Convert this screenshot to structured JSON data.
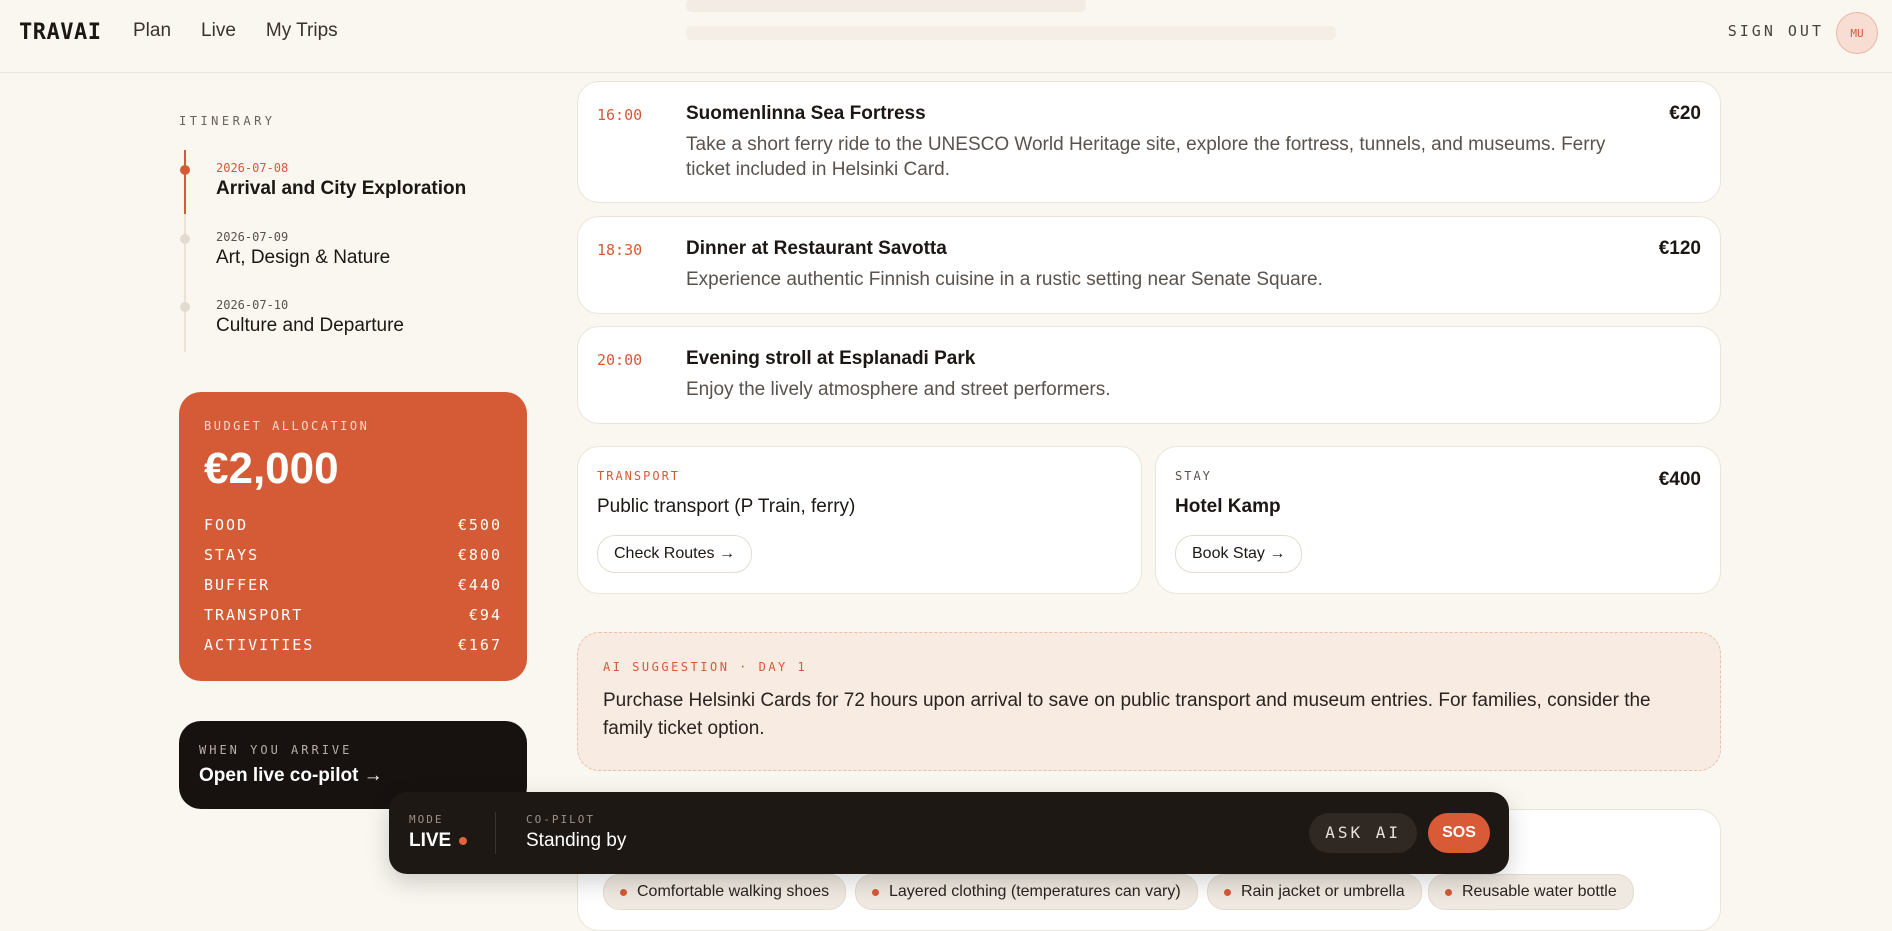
{
  "header": {
    "logo": "TRAVAI",
    "nav": [
      "Plan",
      "Live",
      "My Trips"
    ],
    "sign_out": "SIGN OUT",
    "avatar": "MU"
  },
  "sidebar": {
    "itinerary_label": "ITINERARY",
    "days": [
      {
        "date": "2026-07-08",
        "title": "Arrival and City Exploration",
        "active": true
      },
      {
        "date": "2026-07-09",
        "title": "Art, Design & Nature",
        "active": false
      },
      {
        "date": "2026-07-10",
        "title": "Culture and Departure",
        "active": false
      }
    ],
    "budget": {
      "label": "BUDGET ALLOCATION",
      "total": "€2,000",
      "rows": [
        {
          "label": "FOOD",
          "value": "€500"
        },
        {
          "label": "STAYS",
          "value": "€800"
        },
        {
          "label": "BUFFER",
          "value": "€440"
        },
        {
          "label": "TRANSPORT",
          "value": "€94"
        },
        {
          "label": "ACTIVITIES",
          "value": "€167"
        }
      ]
    },
    "copilot_card": {
      "label": "WHEN YOU ARRIVE",
      "link": "Open live co-pilot →"
    }
  },
  "activities": [
    {
      "time": "16:00",
      "title": "Suomenlinna Sea Fortress",
      "desc": "Take a short ferry ride to the UNESCO World Heritage site, explore the fortress, tunnels, and museums. Ferry ticket included in Helsinki Card.",
      "price": "€20"
    },
    {
      "time": "18:30",
      "title": "Dinner at Restaurant Savotta",
      "desc": "Experience authentic Finnish cuisine in a rustic setting near Senate Square.",
      "price": "€120"
    },
    {
      "time": "20:00",
      "title": "Evening stroll at Esplanadi Park",
      "desc": "Enjoy the lively atmosphere and street performers.",
      "price": ""
    }
  ],
  "transport": {
    "label": "TRANSPORT",
    "title": "Public transport (P Train, ferry)",
    "button": "Check Routes →"
  },
  "stay": {
    "label": "STAY",
    "title": "Hotel Kamp",
    "price": "€400",
    "button": "Book Stay →"
  },
  "ai_suggestion": {
    "label": "AI SUGGESTION · DAY 1",
    "text": "Purchase Helsinki Cards for 72 hours upon arrival to save on public transport and museum entries. For families, consider the family ticket option."
  },
  "packing": [
    "Comfortable walking shoes",
    "Layered clothing (temperatures can vary)",
    "Rain jacket or umbrella",
    "Reusable water bottle"
  ],
  "floatbar": {
    "mode_label": "MODE",
    "mode": "LIVE",
    "copilot_label": "CO-PILOT",
    "copilot_status": "Standing by",
    "ask_ai": "ASK AI",
    "sos": "SOS"
  },
  "colors": {
    "accent": "#d55b36",
    "background": "#faf6f0",
    "dark": "#1e1814"
  }
}
